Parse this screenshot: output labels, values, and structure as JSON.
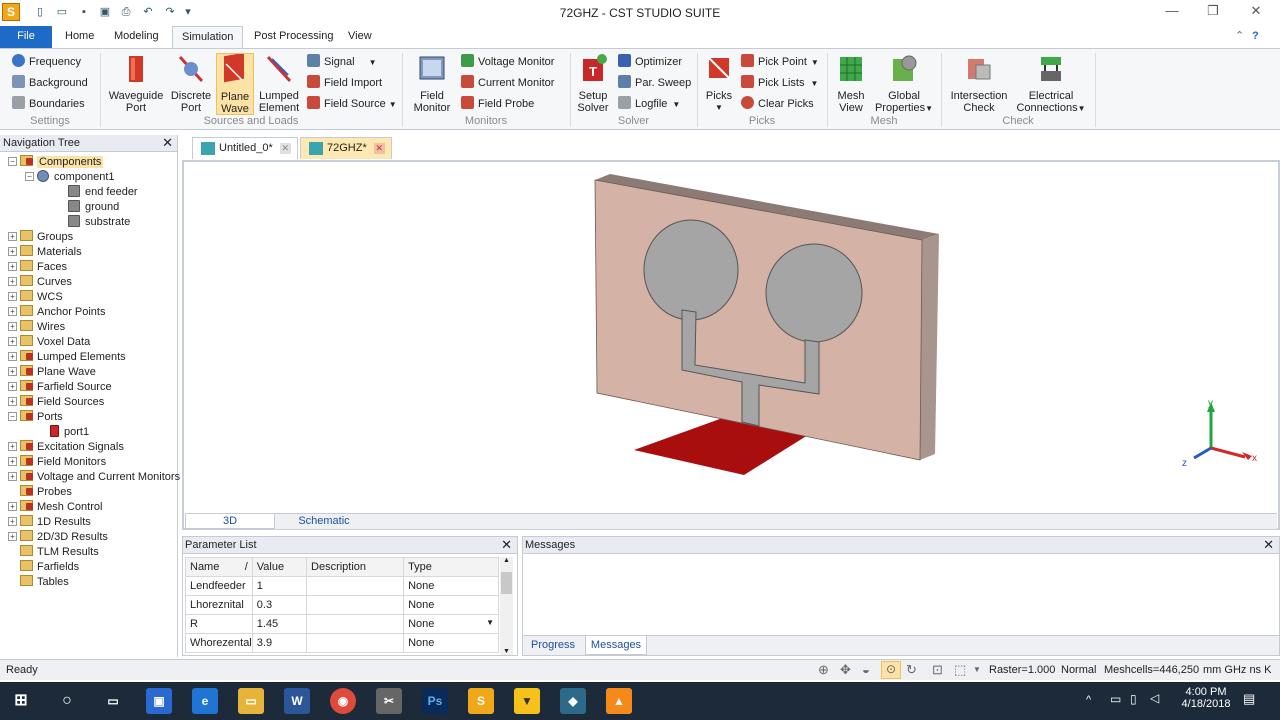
{
  "window": {
    "title": "72GHZ - CST STUDIO SUITE"
  },
  "ribbon_tabs": [
    "File",
    "Home",
    "Modeling",
    "Simulation",
    "Post Processing",
    "View"
  ],
  "ribbon": {
    "settings": {
      "items": [
        "Frequency",
        "Background",
        "Boundaries"
      ],
      "label": "Settings"
    },
    "sources": {
      "waveguide": [
        "Waveguide",
        "Port"
      ],
      "discrete": [
        "Discrete",
        "Port"
      ],
      "plane": [
        "Plane",
        "Wave"
      ],
      "lumped": [
        "Lumped",
        "Element"
      ],
      "small": [
        "Signal",
        "Field Import",
        "Field Source"
      ],
      "label": "Sources and Loads"
    },
    "monitors": {
      "field": [
        "Field",
        "Monitor"
      ],
      "small": [
        "Voltage Monitor",
        "Current Monitor",
        "Field Probe"
      ],
      "label": "Monitors"
    },
    "solver": {
      "setup": [
        "Setup",
        "Solver"
      ],
      "small": [
        "Optimizer",
        "Par. Sweep",
        "Logfile"
      ],
      "label": "Solver"
    },
    "picks": {
      "picks": "Picks",
      "small": [
        "Pick Point",
        "Pick Lists",
        "Clear Picks"
      ],
      "label": "Picks"
    },
    "mesh": {
      "view": [
        "Mesh",
        "View"
      ],
      "global": [
        "Global",
        "Properties"
      ],
      "label": "Mesh"
    },
    "check": {
      "intersection": [
        "Intersection",
        "Check"
      ],
      "electrical": [
        "Electrical",
        "Connections"
      ],
      "label": "Check"
    }
  },
  "nav": {
    "title": "Navigation Tree",
    "components": "Components",
    "component1": "component1",
    "children": [
      "end feeder",
      "ground",
      "substrate"
    ],
    "items_a": [
      "Groups",
      "Materials",
      "Faces",
      "Curves",
      "WCS",
      "Anchor Points",
      "Wires",
      "Voxel Data",
      "Lumped Elements",
      "Plane Wave",
      "Farfield Source",
      "Field Sources",
      "Ports"
    ],
    "port1": "port1",
    "items_b": [
      "Excitation Signals",
      "Field Monitors",
      "Voltage and Current Monitors",
      "Probes",
      "Mesh Control",
      "1D Results",
      "2D/3D Results",
      "TLM Results",
      "Farfields",
      "Tables"
    ]
  },
  "doc_tabs": [
    "Untitled_0*",
    "72GHZ*"
  ],
  "view_tabs": [
    "3D",
    "Schematic"
  ],
  "axes": {
    "x": "x",
    "y": "y",
    "z": "z"
  },
  "colors": {
    "substrate": "#d4b2a6",
    "patch": "#a5a5a5",
    "ground_plane": "#a80e0e"
  },
  "params": {
    "title": "Parameter List",
    "columns": [
      "Name",
      "Value",
      "Description",
      "Type"
    ],
    "sort_marker": "/",
    "rows": [
      {
        "name": "Lendfeeder",
        "value": "1",
        "desc": "",
        "type": "None"
      },
      {
        "name": "Lhoreznital",
        "value": "0.3",
        "desc": "",
        "type": "None"
      },
      {
        "name": "R",
        "value": "1.45",
        "desc": "",
        "type": "None"
      },
      {
        "name": "Whorezental",
        "value": "3.9",
        "desc": "",
        "type": "None"
      }
    ]
  },
  "messages": {
    "title": "Messages",
    "tabs": [
      "Progress",
      "Messages"
    ]
  },
  "status": {
    "ready": "Ready",
    "raster": "Raster=1.000",
    "mode": "Normal",
    "meshcells": "Meshcells=446,250",
    "units": "mm  GHz  ns  K"
  },
  "taskbar": {
    "time": "4:00 PM",
    "date": "4/18/2018"
  }
}
